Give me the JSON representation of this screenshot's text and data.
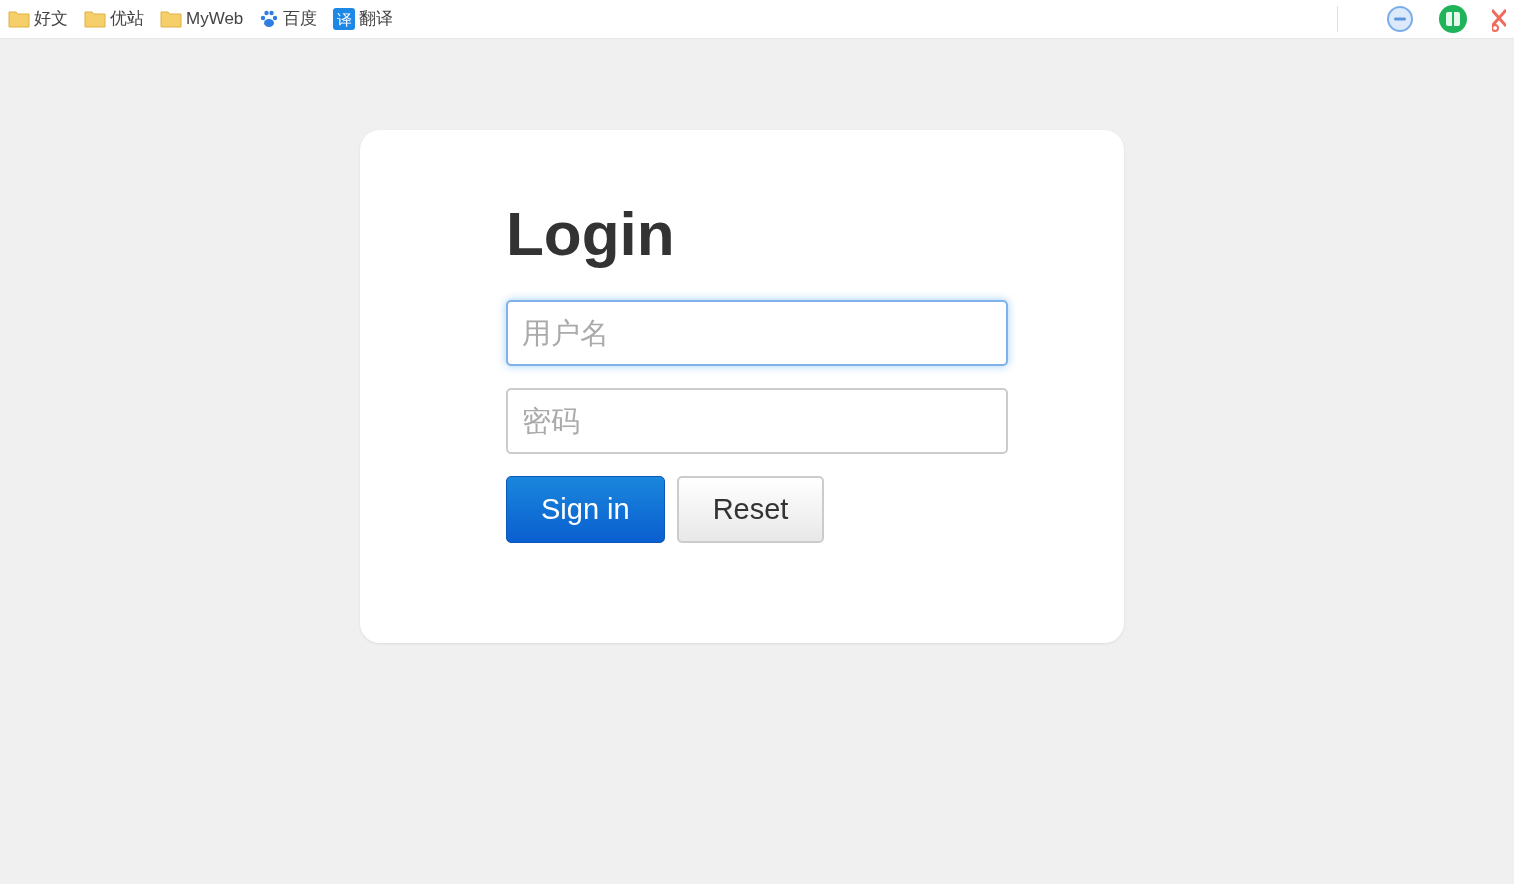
{
  "bookmarks": [
    {
      "kind": "folder",
      "label": "好文"
    },
    {
      "kind": "folder",
      "label": "优站"
    },
    {
      "kind": "folder",
      "label": "MyWeb"
    },
    {
      "kind": "paw",
      "label": "百度"
    },
    {
      "kind": "translate",
      "icon_text": "译",
      "label": "翻译"
    }
  ],
  "login": {
    "title": "Login",
    "fields": [
      {
        "placeholder": "用户名",
        "focused": true
      },
      {
        "placeholder": "密码",
        "focused": false
      }
    ],
    "buttons": [
      {
        "label": "Sign in",
        "kind": "primary"
      },
      {
        "label": "Reset",
        "kind": "default"
      }
    ]
  }
}
